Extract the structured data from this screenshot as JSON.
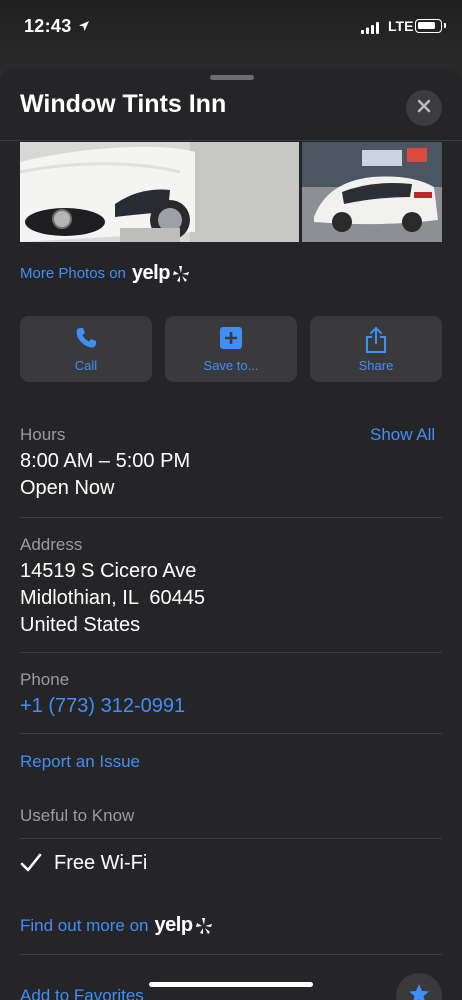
{
  "status": {
    "time": "12:43",
    "network": "LTE"
  },
  "sheet": {
    "title": "Window Tints Inn",
    "more_photos": {
      "text": "More Photos on",
      "brand": "yelp"
    },
    "actions": [
      {
        "label": "Call",
        "icon": "phone-icon"
      },
      {
        "label": "Save to...",
        "icon": "plus-square-icon"
      },
      {
        "label": "Share",
        "icon": "share-icon"
      }
    ],
    "hours": {
      "label": "Hours",
      "show_all": "Show All",
      "time": "8:00 AM – 5:00 PM",
      "status": "Open Now"
    },
    "address": {
      "label": "Address",
      "line1": "14519 S Cicero Ave",
      "line2": "Midlothian, IL  60445",
      "line3": "United States"
    },
    "phone": {
      "label": "Phone",
      "number": "+1 (773) 312-0991"
    },
    "report": "Report an Issue",
    "useful": {
      "label": "Useful to Know",
      "item": "Free Wi-Fi"
    },
    "find_out": {
      "text": "Find out more on",
      "brand": "yelp"
    },
    "favorites": "Add to Favorites"
  },
  "colors": {
    "accent": "#3f8ff5",
    "sheet_bg": "#252527",
    "button_bg": "#3a3a3d"
  }
}
